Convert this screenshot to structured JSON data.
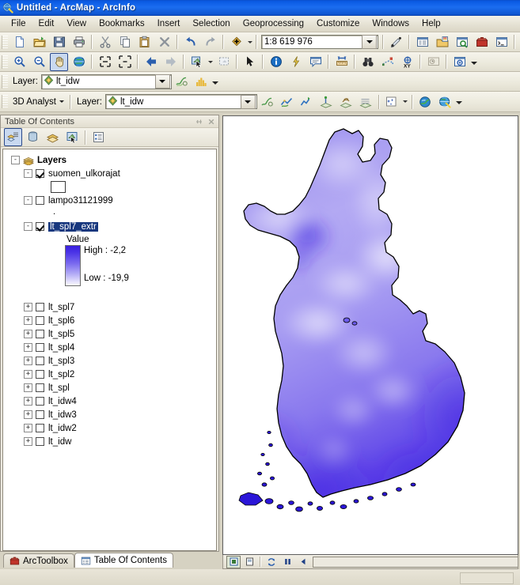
{
  "window": {
    "title": "Untitled - ArcMap - ArcInfo",
    "icon": "arcmap-globe-icon"
  },
  "menubar": {
    "items": [
      {
        "label": "File",
        "name": "menu-file"
      },
      {
        "label": "Edit",
        "name": "menu-edit"
      },
      {
        "label": "View",
        "name": "menu-view"
      },
      {
        "label": "Bookmarks",
        "name": "menu-bookmarks"
      },
      {
        "label": "Insert",
        "name": "menu-insert"
      },
      {
        "label": "Selection",
        "name": "menu-selection"
      },
      {
        "label": "Geoprocessing",
        "name": "menu-geoprocessing"
      },
      {
        "label": "Customize",
        "name": "menu-customize"
      },
      {
        "label": "Windows",
        "name": "menu-windows"
      },
      {
        "label": "Help",
        "name": "menu-help"
      }
    ]
  },
  "standard_toolbar": {
    "buttons": [
      "new-document-icon",
      "open-folder-icon",
      "save-icon",
      "print-icon",
      "cut-scissors-icon",
      "copy-icon",
      "paste-icon",
      "delete-x-icon",
      "undo-arrow-icon",
      "redo-arrow-icon",
      "add-data-icon"
    ],
    "scale": {
      "label": "map-scale",
      "value": "1:8 619 976"
    },
    "right_buttons": [
      "editor-toolbar-icon",
      "table-of-contents-icon",
      "catalog-icon",
      "search-icon",
      "arctoolbox-icon",
      "python-window-icon",
      "modelbuilder-icon",
      "whats-this-help-icon"
    ]
  },
  "tools_toolbar": {
    "buttons": [
      "zoom-in-icon",
      "zoom-out-icon",
      "pan-hand-icon",
      "full-extent-globe-icon",
      "fixed-zoom-in-icon",
      "fixed-zoom-out-icon",
      "back-extent-icon",
      "forward-extent-icon",
      "select-features-icon",
      "select-elements-icon",
      "arrow-pointer-icon",
      "identify-info-icon",
      "hyperlink-icon",
      "html-popup-icon",
      "measure-icon",
      "find-binoculars-icon",
      "find-route-icon",
      "go-to-xy-icon",
      "time-slider-icon",
      "create-viewer-window-icon"
    ],
    "active": "pan-hand-icon"
  },
  "spatial_analyst_toolbar": {
    "layer_label": "Layer:",
    "layer_value": "lt_idw",
    "buttons": [
      "spatial-analyst-menu-icon",
      "histogram-icon"
    ]
  },
  "threed_analyst_toolbar": {
    "menu_label": "3D Analyst",
    "layer_label": "Layer:",
    "layer_value": "lt_idw",
    "buttons": [
      "threed-analyst-menu-icon",
      "interpolate-line-icon",
      "create-profile-icon",
      "steepest-path-icon",
      "contour-icon",
      "surface-length-icon",
      "point-cloud-icon",
      "arcscene-icon",
      "arcglobe-icon"
    ]
  },
  "table_of_contents": {
    "title": "Table Of Contents",
    "panel_buttons": [
      "list-by-drawing-order-icon",
      "list-by-source-icon",
      "list-by-visibility-icon",
      "list-by-selection-icon",
      "options-icon"
    ],
    "panel_active": "list-by-drawing-order-icon",
    "titlebar_actions": [
      "auto-hide-pin-icon",
      "close-icon"
    ],
    "root": {
      "label": "Layers",
      "icon": "data-frame-layers-icon",
      "expander": "-"
    },
    "layers": [
      {
        "name": "suomen_ulkorajat",
        "checked": true,
        "expander": "-",
        "symbol": "polygon-white-swatch"
      },
      {
        "name": "lampo31121999",
        "checked": false,
        "expander": "-",
        "symbol": "point-dot"
      },
      {
        "name": "lt_spl7_extr",
        "checked": true,
        "expander": "-",
        "selected": true,
        "legend": {
          "heading": "Value",
          "high": "High : -2,2",
          "low": "Low : -19,9",
          "ramp_top": "#3a20e0",
          "ramp_bottom": "#fbfbff"
        }
      },
      {
        "name": "lt_spl7",
        "checked": false,
        "expander": "+"
      },
      {
        "name": "lt_spl6",
        "checked": false,
        "expander": "+"
      },
      {
        "name": "lt_spl5",
        "checked": false,
        "expander": "+"
      },
      {
        "name": "lt_spl4",
        "checked": false,
        "expander": "+"
      },
      {
        "name": "lt_spl3",
        "checked": false,
        "expander": "+"
      },
      {
        "name": "lt_spl2",
        "checked": false,
        "expander": "+"
      },
      {
        "name": "lt_spl",
        "checked": false,
        "expander": "+"
      },
      {
        "name": "lt_idw4",
        "checked": false,
        "expander": "+"
      },
      {
        "name": "lt_idw3",
        "checked": false,
        "expander": "+"
      },
      {
        "name": "lt_idw2",
        "checked": false,
        "expander": "+"
      },
      {
        "name": "lt_idw",
        "checked": false,
        "expander": "+"
      }
    ]
  },
  "bottom_tabs": [
    {
      "label": "ArcToolbox",
      "icon": "arctoolbox-icon",
      "active": false
    },
    {
      "label": "Table Of Contents",
      "icon": "toc-icon",
      "active": true
    }
  ],
  "map_view_bar": {
    "buttons": [
      "data-view-icon",
      "layout-view-icon",
      "refresh-icon",
      "pause-drawing-icon",
      "continue-icon"
    ],
    "active": "data-view-icon"
  },
  "map": {
    "description": "Interpolated temperature raster of Finland clipped to national border",
    "background": "#ffffff",
    "outline_color": "#000000",
    "ramp_low": "#3a20e0",
    "ramp_high": "#efeeff"
  }
}
